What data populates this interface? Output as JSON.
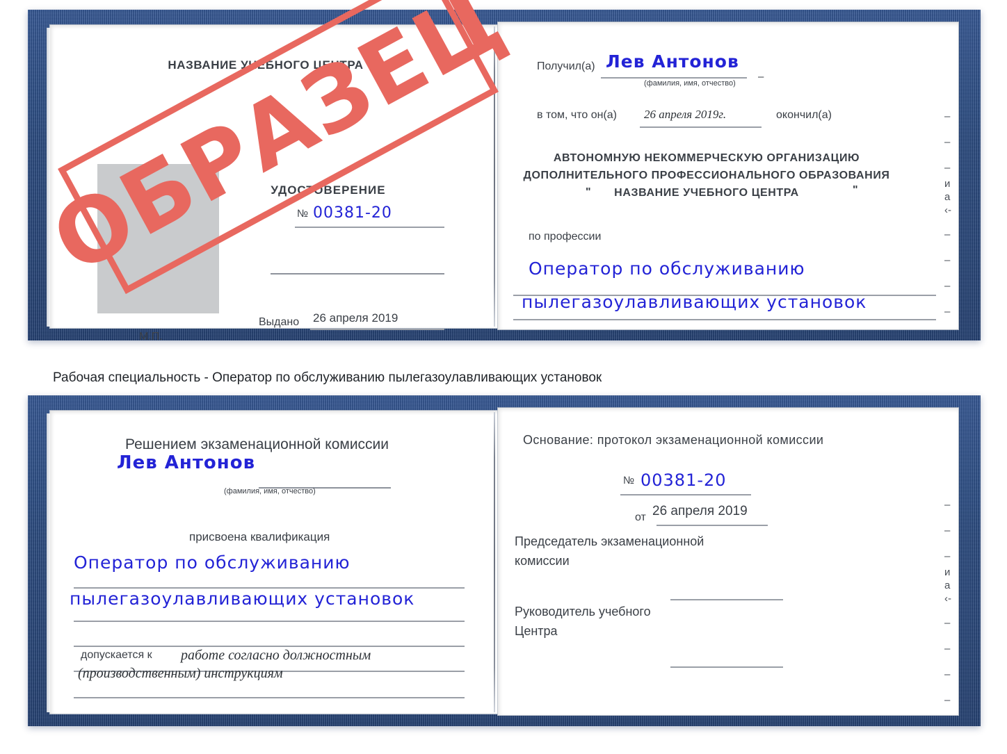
{
  "caption": "Рабочая специальность - Оператор по обслуживанию пылегазоулавливающих установок",
  "colors": {
    "cover_blue": "#23467f",
    "stamp_red": "#e8685f",
    "handwriting_blue": "#2323d6",
    "paper_white": "#ffffff",
    "photo_placeholder_gray": "#c9cbcd"
  },
  "stamp": {
    "text": "ОБРАЗЕЦ"
  },
  "certificate_top": {
    "left_page": {
      "header": "НАЗВАНИЕ УЧЕБНОГО ЦЕНТРА",
      "doc_type": "УДОСТОВЕРЕНИЕ",
      "number_label": "№",
      "number_value": "00381-20",
      "issued_label": "Выдано",
      "issued_value": "26 апреля 2019",
      "seal_label": "М.П.",
      "photo_placeholder": "photo-placeholder"
    },
    "right_page": {
      "received_label": "Получил(а)",
      "received_value": "Лев Антонов",
      "fio_hint": "(фамилия, имя, отчество)",
      "that_he_label": "в том, что он(а)",
      "completion_date": "26 апреля 2019г.",
      "finished_label": "окончил(а)",
      "org_line1": "АВТОНОМНУЮ НЕКОММЕРЧЕСКУЮ ОРГАНИЗАЦИЮ",
      "org_line2": "ДОПОЛНИТЕЛЬНОГО ПРОФЕССИОНАЛЬНОГО ОБРАЗОВАНИЯ",
      "org_quote_open": "\"",
      "org_name": "НАЗВАНИЕ УЧЕБНОГО ЦЕНТРА",
      "org_quote_close": "\"",
      "profession_label": "по профессии",
      "profession_line1": "Оператор по обслуживанию",
      "profession_line2": "пылегазоулавливающих установок",
      "margin_glyphs": [
        "–",
        "–",
        "–",
        "и",
        "а",
        "‹-",
        "–",
        "–",
        "–",
        "–"
      ]
    }
  },
  "certificate_bottom": {
    "left_page": {
      "header": "Решением экзаменационной комиссии",
      "name_value": "Лев Антонов",
      "fio_hint": "(фамилия, имя, отчество)",
      "qualification_label": "присвоена квалификация",
      "qualification_line1": "Оператор по обслуживанию",
      "qualification_line2": "пылегазоулавливающих установок",
      "admitted_label": "допускается к",
      "admitted_value_line1": "работе согласно должностным",
      "admitted_value_line2": "(производственным) инструкциям"
    },
    "right_page": {
      "basis_label": "Основание: протокол экзаменационной комиссии",
      "number_label": "№",
      "number_value": "00381-20",
      "date_label": "от",
      "date_value": "26 апреля 2019",
      "chairman_line1": "Председатель экзаменационной",
      "chairman_line2": "комиссии",
      "director_line1": "Руководитель учебного",
      "director_line2": "Центра",
      "margin_glyphs": [
        "–",
        "–",
        "–",
        "и",
        "а",
        "‹-",
        "–",
        "–",
        "–",
        "–"
      ]
    }
  }
}
